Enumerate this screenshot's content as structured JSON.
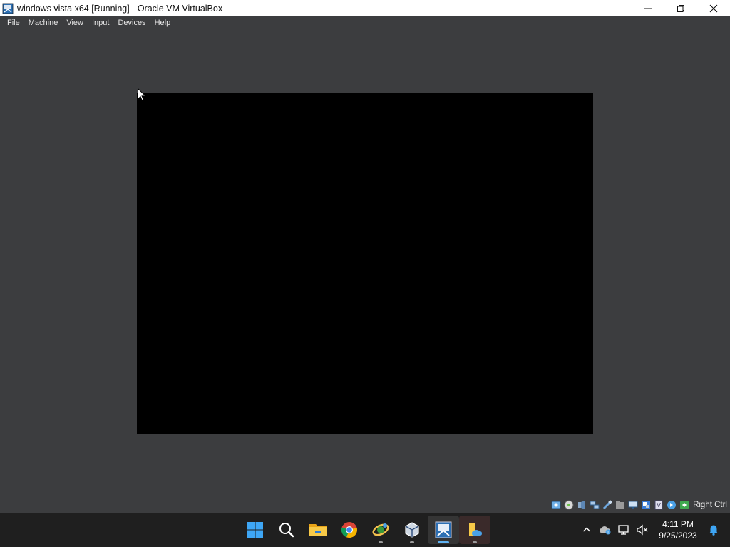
{
  "window": {
    "title": "windows vista x64 [Running] - Oracle VM VirtualBox",
    "minimize_icon": "minimize-icon",
    "maximize_icon": "maximize-icon",
    "close_icon": "close-icon"
  },
  "menu": {
    "items": [
      {
        "label": "File"
      },
      {
        "label": "Machine"
      },
      {
        "label": "View"
      },
      {
        "label": "Input"
      },
      {
        "label": "Devices"
      },
      {
        "label": "Help"
      }
    ]
  },
  "vm": {
    "screen_color": "#000000",
    "background_color": "#3c3d3f"
  },
  "statusbar": {
    "icons": [
      "hard-disk-icon",
      "optical-drive-icon",
      "audio-icon",
      "network-icon",
      "usb-icon",
      "shared-folders-icon",
      "display-icon",
      "recording-icon",
      "cpu-icon",
      "mouse-integration-icon",
      "keyboard-icon"
    ],
    "host_key": "Right Ctrl"
  },
  "taskbar": {
    "apps": [
      "start-icon",
      "search-icon",
      "file-explorer-icon",
      "chrome-icon",
      "network-app-icon",
      "virtualbox-icon",
      "vista-vm-icon",
      "files-app-icon"
    ],
    "tray_icons": [
      "chevron-up-icon",
      "onedrive-icon",
      "network-tray-icon",
      "volume-muted-icon"
    ],
    "time": "4:11 PM",
    "date": "9/25/2023",
    "notification_icon": "bell-icon"
  }
}
